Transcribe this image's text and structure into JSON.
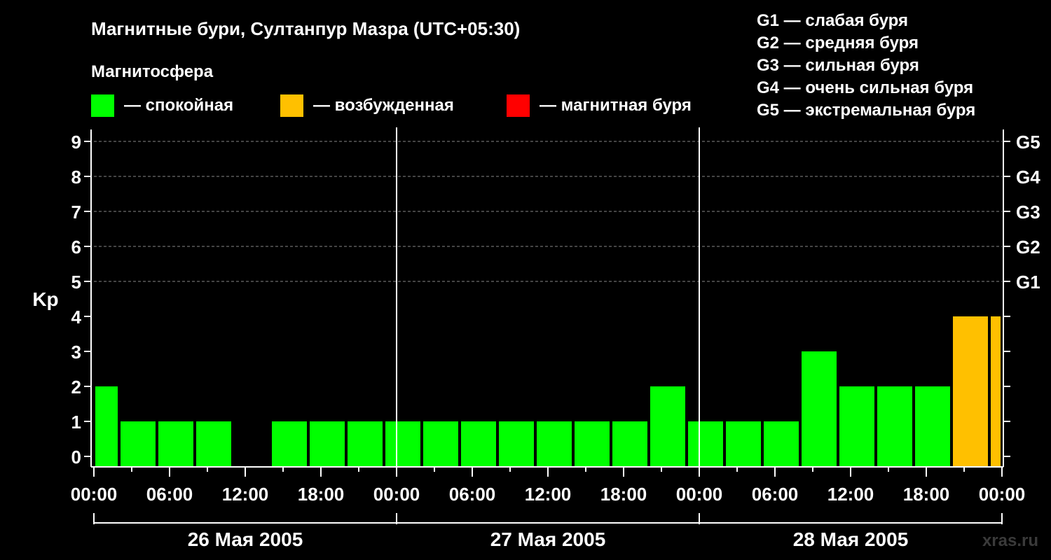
{
  "chart_data": {
    "type": "bar",
    "title": "Магнитные бури, Султанпур Мазра (UTC+05:30)",
    "subtitle": "Магнитосфера",
    "ylabel": "Kp",
    "ylim": [
      0,
      9
    ],
    "yticks": [
      "0",
      "1",
      "2",
      "3",
      "4",
      "5",
      "6",
      "7",
      "8",
      "9"
    ],
    "storm_levels": [
      {
        "label": "G1",
        "kp": 5
      },
      {
        "label": "G2",
        "kp": 6
      },
      {
        "label": "G3",
        "kp": 7
      },
      {
        "label": "G4",
        "kp": 8
      },
      {
        "label": "G5",
        "kp": 9
      }
    ],
    "storm_legend": [
      "G1 — слабая буря",
      "G2 — средняя буря",
      "G3 — сильная буря",
      "G4 — очень сильная буря",
      "G5 — экстремальная буря"
    ],
    "magnetosphere_legend": [
      {
        "label": "— спокойная",
        "color": "#00ff00"
      },
      {
        "label": "— возбужденная",
        "color": "#ffc000"
      },
      {
        "label": "— магнитная буря",
        "color": "#ff0000"
      }
    ],
    "x_range_hours": [
      0,
      72
    ],
    "time_ticks": [
      "00:00",
      "06:00",
      "12:00",
      "18:00",
      "00:00",
      "06:00",
      "12:00",
      "18:00",
      "00:00",
      "06:00",
      "12:00",
      "18:00",
      "00:00"
    ],
    "days": [
      "26 Мая 2005",
      "27 Мая 2005",
      "28 Мая 2005"
    ],
    "grid": "dashed horizontal at Kp 5–9",
    "bars": [
      {
        "start": 0,
        "end": 2,
        "kp": 2,
        "color": "#00ff00"
      },
      {
        "start": 2,
        "end": 5,
        "kp": 1,
        "color": "#00ff00"
      },
      {
        "start": 5,
        "end": 8,
        "kp": 1,
        "color": "#00ff00"
      },
      {
        "start": 8,
        "end": 11,
        "kp": 1,
        "color": "#00ff00"
      },
      {
        "start": 11,
        "end": 14,
        "kp": 0,
        "color": "#00ff00"
      },
      {
        "start": 14,
        "end": 17,
        "kp": 1,
        "color": "#00ff00"
      },
      {
        "start": 17,
        "end": 20,
        "kp": 1,
        "color": "#00ff00"
      },
      {
        "start": 20,
        "end": 23,
        "kp": 1,
        "color": "#00ff00"
      },
      {
        "start": 23,
        "end": 26,
        "kp": 1,
        "color": "#00ff00"
      },
      {
        "start": 26,
        "end": 29,
        "kp": 1,
        "color": "#00ff00"
      },
      {
        "start": 29,
        "end": 32,
        "kp": 1,
        "color": "#00ff00"
      },
      {
        "start": 32,
        "end": 35,
        "kp": 1,
        "color": "#00ff00"
      },
      {
        "start": 35,
        "end": 38,
        "kp": 1,
        "color": "#00ff00"
      },
      {
        "start": 38,
        "end": 41,
        "kp": 1,
        "color": "#00ff00"
      },
      {
        "start": 41,
        "end": 44,
        "kp": 1,
        "color": "#00ff00"
      },
      {
        "start": 44,
        "end": 47,
        "kp": 2,
        "color": "#00ff00"
      },
      {
        "start": 47,
        "end": 50,
        "kp": 1,
        "color": "#00ff00"
      },
      {
        "start": 50,
        "end": 53,
        "kp": 1,
        "color": "#00ff00"
      },
      {
        "start": 53,
        "end": 56,
        "kp": 1,
        "color": "#00ff00"
      },
      {
        "start": 56,
        "end": 59,
        "kp": 3,
        "color": "#00ff00"
      },
      {
        "start": 59,
        "end": 62,
        "kp": 2,
        "color": "#00ff00"
      },
      {
        "start": 62,
        "end": 65,
        "kp": 2,
        "color": "#00ff00"
      },
      {
        "start": 65,
        "end": 68,
        "kp": 2,
        "color": "#00ff00"
      },
      {
        "start": 68,
        "end": 71,
        "kp": 4,
        "color": "#ffc000"
      },
      {
        "start": 71,
        "end": 72,
        "kp": 4,
        "color": "#ffc000"
      }
    ]
  },
  "watermark": "xras.ru"
}
